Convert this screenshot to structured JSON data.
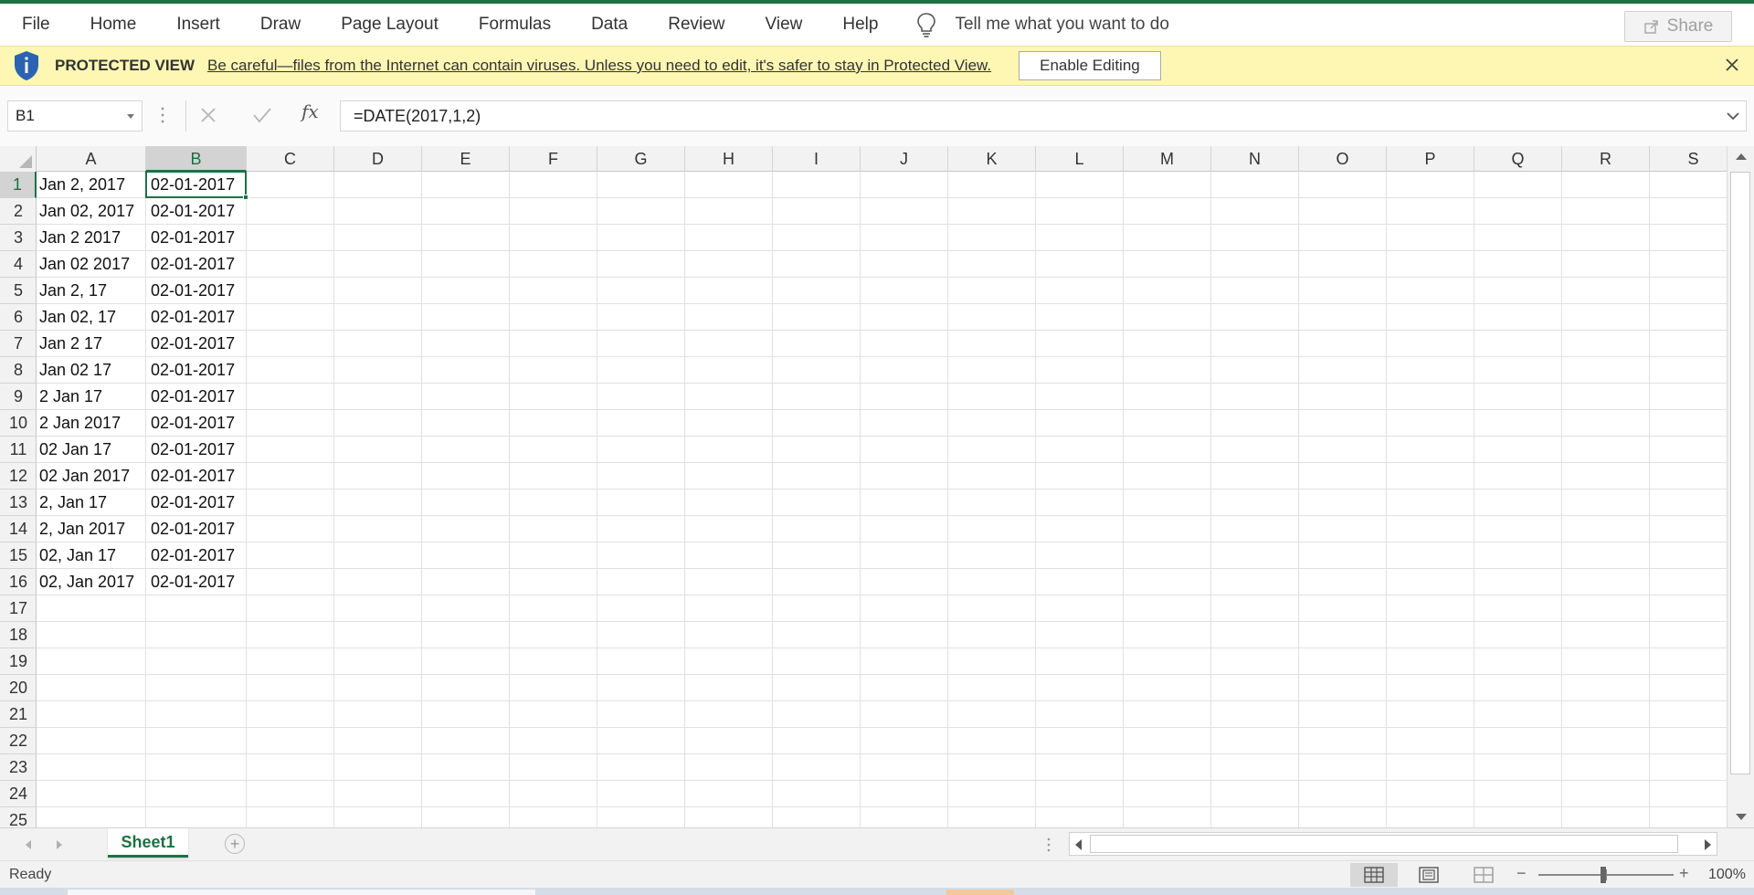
{
  "menu": {
    "items": [
      "File",
      "Home",
      "Insert",
      "Draw",
      "Page Layout",
      "Formulas",
      "Data",
      "Review",
      "View",
      "Help"
    ],
    "tell_me": "Tell me what you want to do",
    "share": "Share"
  },
  "protected_view": {
    "title": "PROTECTED VIEW",
    "message": "Be careful—files from the Internet can contain viruses. Unless you need to edit, it's safer to stay in Protected View.",
    "enable_button": "Enable Editing",
    "bar_color": "#fdf7b3"
  },
  "formula_bar": {
    "name_box": "B1",
    "fx_symbol": "fx",
    "formula": "=DATE(2017,1,2)"
  },
  "grid": {
    "columns": [
      "A",
      "B",
      "C",
      "D",
      "E",
      "F",
      "G",
      "H",
      "I",
      "J",
      "K",
      "L",
      "M",
      "N",
      "O",
      "P",
      "Q",
      "R",
      "S"
    ],
    "rows": [
      "1",
      "2",
      "3",
      "4",
      "5",
      "6",
      "7",
      "8",
      "9",
      "10",
      "11",
      "12",
      "13",
      "14",
      "15",
      "16",
      "17",
      "18",
      "19",
      "20",
      "21",
      "22",
      "23",
      "24",
      "25"
    ],
    "active_cell": "B1",
    "column_a": [
      "Jan 2, 2017",
      "Jan 02, 2017",
      "Jan 2 2017",
      "Jan 02 2017",
      "Jan 2, 17",
      "Jan 02, 17",
      "Jan 2 17",
      "Jan 02 17",
      "2 Jan 17",
      "2 Jan 2017",
      "02 Jan 17",
      "02 Jan 2017",
      "2, Jan 17",
      "2, Jan 2017",
      "02, Jan 17",
      "02, Jan 2017"
    ],
    "column_b": [
      "02-01-2017",
      "02-01-2017",
      "02-01-2017",
      "02-01-2017",
      "02-01-2017",
      "02-01-2017",
      "02-01-2017",
      "02-01-2017",
      "02-01-2017",
      "02-01-2017",
      "02-01-2017",
      "02-01-2017",
      "02-01-2017",
      "02-01-2017",
      "02-01-2017",
      "02-01-2017"
    ]
  },
  "sheets": {
    "tabs": [
      "Sheet1"
    ],
    "active": "Sheet1",
    "add_symbol": "+"
  },
  "status": {
    "text": "Ready",
    "zoom": "100%"
  },
  "colors": {
    "accent": "#1e7145",
    "header_bg": "#f2f2f2",
    "gridline": "#e1e1e1"
  }
}
